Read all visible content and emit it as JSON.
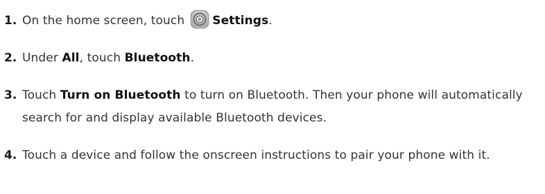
{
  "steps": [
    {
      "number": "1.",
      "before": "On the home screen, touch",
      "icon": "settings-icon",
      "bold": "Settings",
      "after": "."
    },
    {
      "number": "2.",
      "before": "Under ",
      "bold1": "All",
      "middle": ", touch ",
      "bold2": "Bluetooth",
      "after": "."
    },
    {
      "number": "3.",
      "before": "Touch ",
      "bold": "Turn on Bluetooth",
      "after": " to turn on Bluetooth. Then your phone will automatically search for and display available Bluetooth devices."
    },
    {
      "number": "4.",
      "text": "Touch a device and follow the onscreen instructions to pair your phone with it."
    }
  ],
  "colors": {
    "text": "#333333",
    "bold": "#111111",
    "icon_ring": "#7a7a7a",
    "icon_face": "#d4d4d4"
  }
}
